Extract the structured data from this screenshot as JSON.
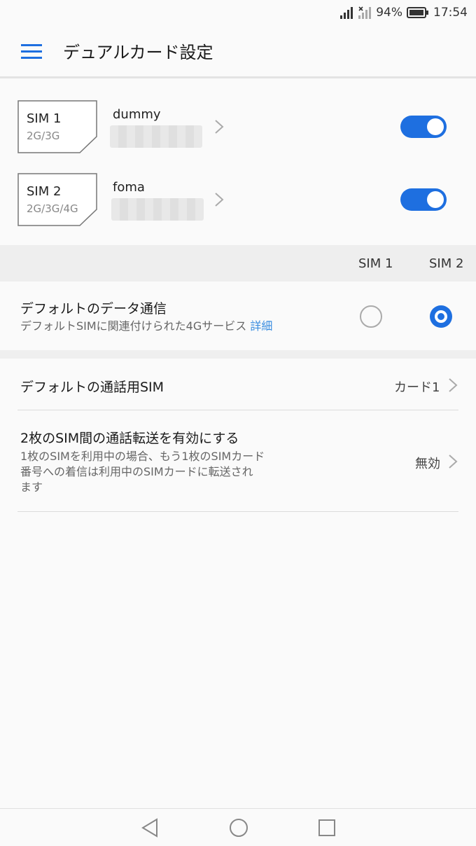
{
  "status_bar": {
    "battery": "94%",
    "time": "17:54"
  },
  "app_bar": {
    "title": "デュアルカード設定"
  },
  "sims": [
    {
      "name": "SIM 1",
      "network": "2G/3G",
      "carrier": "dummy",
      "enabled": true
    },
    {
      "name": "SIM 2",
      "network": "2G/3G/4G",
      "carrier": "foma",
      "enabled": true
    }
  ],
  "columns": {
    "sim1": "SIM 1",
    "sim2": "SIM 2"
  },
  "default_data": {
    "title": "デフォルトのデータ通信",
    "subtitle": "デフォルトSIMに関連付けられた4Gサービス",
    "link": "詳細",
    "selected": "SIM 2"
  },
  "default_call": {
    "title": "デフォルトの通話用SIM",
    "value": "カード1"
  },
  "call_forward": {
    "title": "2枚のSIM間の通話転送を有効にする",
    "desc_line1": "1枚のSIMを利用中の場合、もう1枚のSIMカード",
    "desc_line2": "番号への着信は利用中のSIMカードに転送され",
    "desc_line3": "ます",
    "value": "無効"
  },
  "colors": {
    "accent": "#1e6fe0",
    "link": "#3a8de0"
  }
}
